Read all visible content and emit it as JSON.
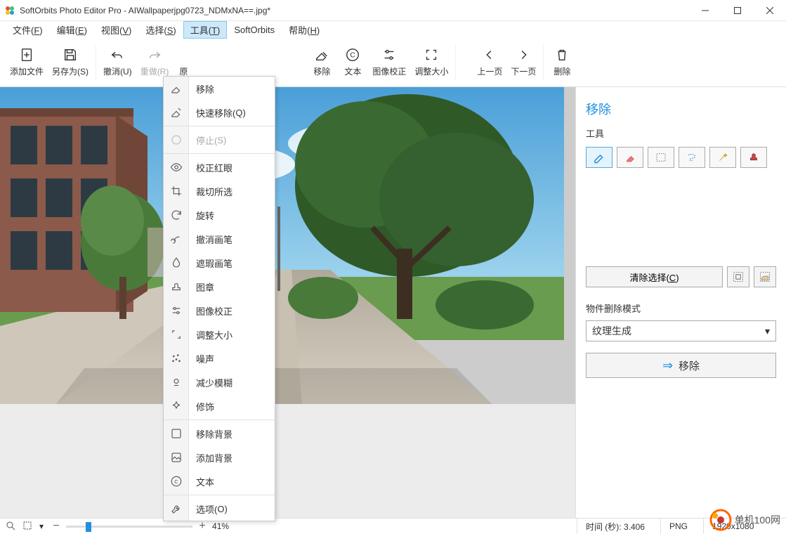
{
  "title": "SoftOrbits Photo Editor Pro - AIWallpaperjpg0723_NDMxNA==.jpg*",
  "menu": {
    "file": "文件(F)",
    "edit": "编辑(E)",
    "view": "视图(V)",
    "select": "选择(S)",
    "tools": "工具(T)",
    "softorbits": "SoftOrbits",
    "help": "帮助(H)"
  },
  "toolbar": {
    "add_file": "添加文件",
    "save_as": "另存为(S)",
    "undo": "撤消(U)",
    "redo": "重做(R)",
    "orig": "原",
    "remove": "移除",
    "text": "文本",
    "correction": "图像校正",
    "resize": "调整大小",
    "prev": "上一页",
    "next": "下一页",
    "delete": "删除"
  },
  "dropdown": [
    {
      "label": "移除",
      "icon": "eraser"
    },
    {
      "label": "快速移除(Q)",
      "icon": "eraser-quick"
    },
    {
      "sep": true
    },
    {
      "label": "停止(S)",
      "icon": "stop",
      "disabled": true
    },
    {
      "sep": true
    },
    {
      "label": "校正红眼",
      "icon": "eye"
    },
    {
      "label": "裁切所选",
      "icon": "crop"
    },
    {
      "label": "旋转",
      "icon": "rotate"
    },
    {
      "label": "撤消画笔",
      "icon": "brush-undo"
    },
    {
      "label": "遮瑕画笔",
      "icon": "drop"
    },
    {
      "label": "图章",
      "icon": "stamp"
    },
    {
      "label": "图像校正",
      "icon": "sliders"
    },
    {
      "label": "调整大小",
      "icon": "resize"
    },
    {
      "label": "噪声",
      "icon": "noise"
    },
    {
      "label": "减少模糊",
      "icon": "deblur"
    },
    {
      "label": "修饰",
      "icon": "sparkle"
    },
    {
      "sep": true
    },
    {
      "label": "移除背景",
      "icon": "remove-bg"
    },
    {
      "label": "添加背景",
      "icon": "add-bg"
    },
    {
      "label": "文本",
      "icon": "text-circle"
    },
    {
      "sep": true
    },
    {
      "label": "选项(O)",
      "icon": "wrench"
    }
  ],
  "side": {
    "title": "移除",
    "tools_label": "工具",
    "clear_selection": "清除选择(C)",
    "mode_label": "物件删除模式",
    "mode_value": "纹理生成",
    "action": "移除"
  },
  "status": {
    "zoom": "41%",
    "time": "时间 (秒): 3.406",
    "format": "PNG",
    "dims": "1920x1080"
  },
  "watermark": "单机100网"
}
